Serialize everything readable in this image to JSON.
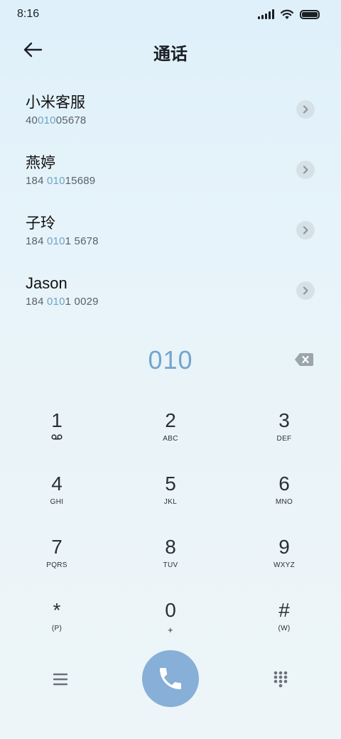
{
  "status_bar": {
    "time": "8:16"
  },
  "header": {
    "title": "通话"
  },
  "contacts": [
    {
      "name": "小米客服",
      "number_prefix": "40",
      "number_match": "010",
      "number_suffix": "05678"
    },
    {
      "name": "燕婷",
      "number_prefix": "184 ",
      "number_match": "010",
      "number_suffix": "15689"
    },
    {
      "name": "子玲",
      "number_prefix": "184 ",
      "number_match": "010",
      "number_suffix": "1 5678"
    },
    {
      "name": "Jason",
      "number_prefix": "184 ",
      "number_match": "010",
      "number_suffix": "1 0029"
    }
  ],
  "dialer": {
    "entered_number": "010"
  },
  "keypad": [
    {
      "digit": "1",
      "sub": ""
    },
    {
      "digit": "2",
      "sub": "ABC"
    },
    {
      "digit": "3",
      "sub": "DEF"
    },
    {
      "digit": "4",
      "sub": "GHI"
    },
    {
      "digit": "5",
      "sub": "JKL"
    },
    {
      "digit": "6",
      "sub": "MNO"
    },
    {
      "digit": "7",
      "sub": "PQRS"
    },
    {
      "digit": "8",
      "sub": "TUV"
    },
    {
      "digit": "9",
      "sub": "WXYZ"
    },
    {
      "digit": "*",
      "sub": "(P)"
    },
    {
      "digit": "0",
      "sub": "+"
    },
    {
      "digit": "#",
      "sub": "(W)"
    }
  ],
  "colors": {
    "accent": "#73a5cf",
    "call_button": "#87afd8",
    "match_highlight": "#6fa3c6"
  },
  "icons": [
    "signal-icon",
    "wifi-icon",
    "battery-icon",
    "back-arrow-icon",
    "chevron-right-icon",
    "backspace-icon",
    "voicemail-icon",
    "menu-icon",
    "phone-icon",
    "keypad-grid-icon"
  ]
}
